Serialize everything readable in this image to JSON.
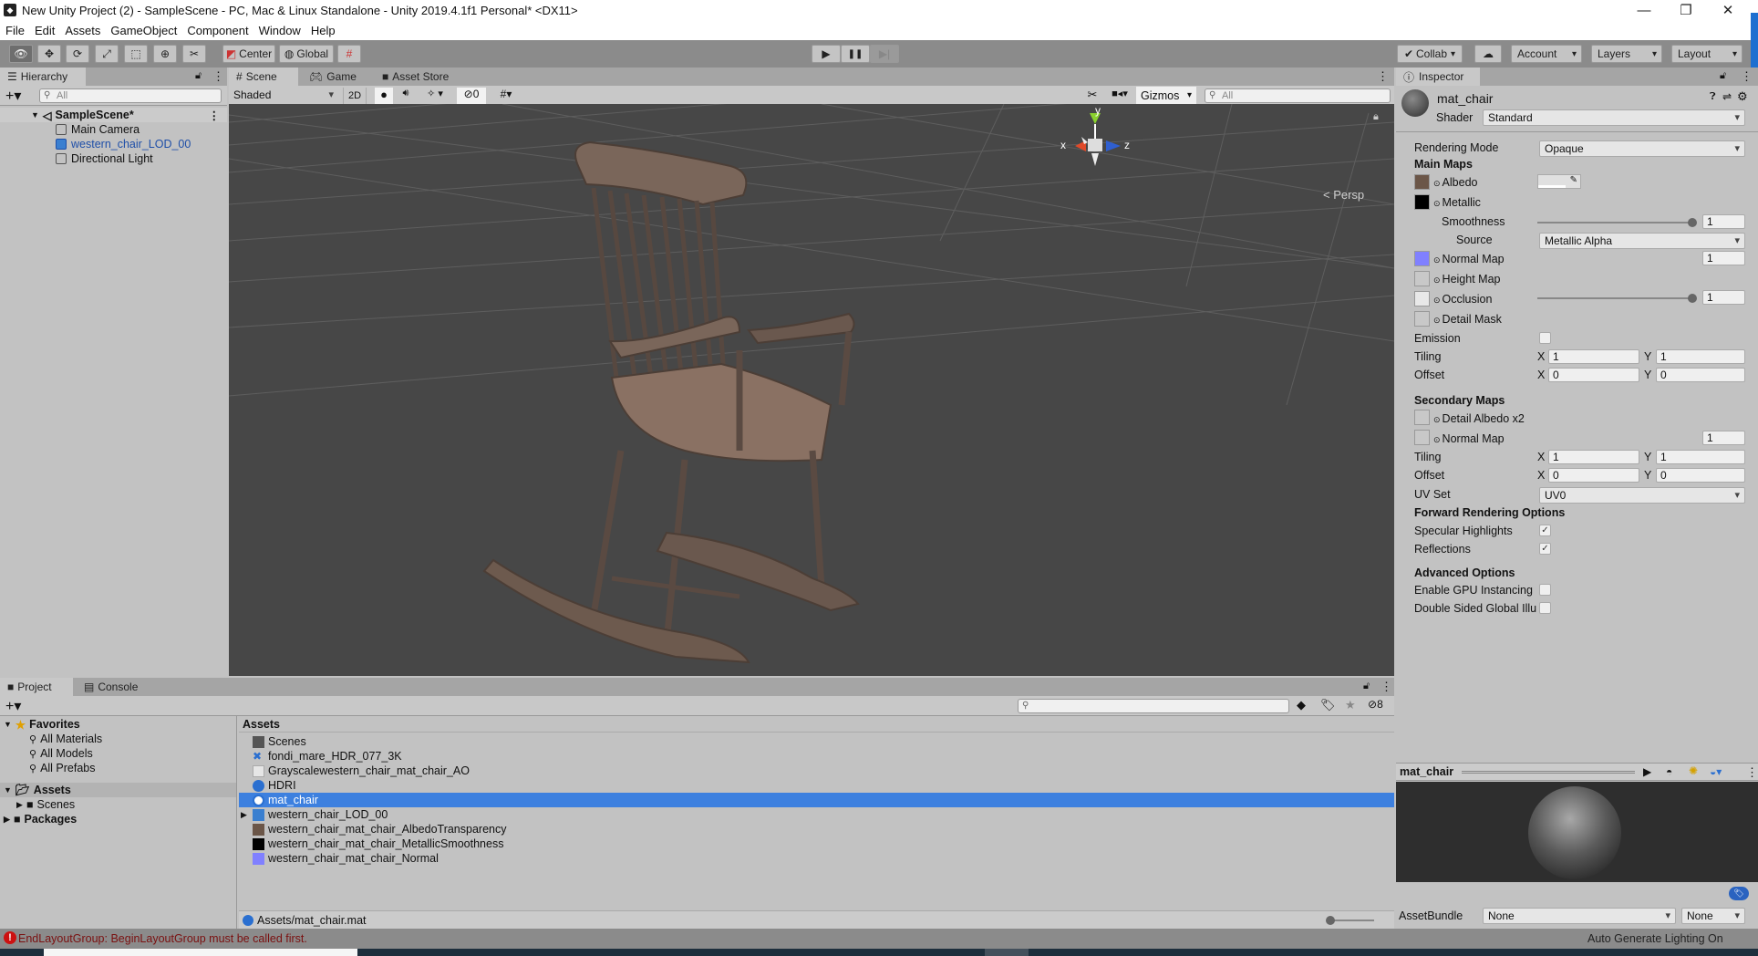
{
  "window": {
    "title": "New Unity Project (2) - SampleScene - PC, Mac & Linux Standalone - Unity 2019.4.1f1 Personal* <DX11>",
    "controls": {
      "minimize": "—",
      "maximize": "❐",
      "close": "✕"
    }
  },
  "menu": [
    "File",
    "Edit",
    "Assets",
    "GameObject",
    "Component",
    "Window",
    "Help"
  ],
  "toolbar": {
    "tools": [
      "view-tool",
      "move-tool",
      "rotate-tool",
      "scale-tool",
      "rect-tool",
      "transform-tool",
      "custom-tool"
    ],
    "pivot_label": "Center",
    "space_label": "Global",
    "play": "▶",
    "pause": "❚❚",
    "step": "▶|",
    "collab_label": "Collab",
    "account_label": "Account",
    "layers_label": "Layers",
    "layout_label": "Layout"
  },
  "hierarchy": {
    "tab": "Hierarchy",
    "search_placeholder": "All",
    "scene": "SampleScene*",
    "items": [
      {
        "label": "Main Camera",
        "selected": false
      },
      {
        "label": "western_chair_LOD_00",
        "prefab": true
      },
      {
        "label": "Directional Light"
      }
    ]
  },
  "scene_view": {
    "tabs": [
      "Scene",
      "Game",
      "Asset Store"
    ],
    "shading": "Shaded",
    "mode_2d": "2D",
    "hidden_count": "0",
    "gizmos_label": "Gizmos",
    "search_placeholder": "All",
    "axis_labels": {
      "x": "x",
      "y": "y",
      "z": "z"
    },
    "projection": "< Persp"
  },
  "inspector": {
    "tab": "Inspector",
    "asset_name": "mat_chair",
    "shader_label": "Shader",
    "shader_value": "Standard",
    "rendering_mode_label": "Rendering Mode",
    "rendering_mode_value": "Opaque",
    "main_maps_header": "Main Maps",
    "albedo": "Albedo",
    "metallic": "Metallic",
    "smoothness_label": "Smoothness",
    "smoothness_value": "1",
    "smoothness_fraction": 1.0,
    "source_label": "Source",
    "source_value": "Metallic Alpha",
    "normal_map": "Normal Map",
    "normal_map_value": "1",
    "height_map": "Height Map",
    "occlusion": "Occlusion",
    "occlusion_value": "1",
    "occlusion_fraction": 1.0,
    "detail_mask": "Detail Mask",
    "emission": "Emission",
    "emission_checked": false,
    "tiling_label": "Tiling",
    "offset_label": "Offset",
    "x": "X",
    "y": "Y",
    "main_tiling": {
      "x": "1",
      "y": "1"
    },
    "main_offset": {
      "x": "0",
      "y": "0"
    },
    "secondary_maps_header": "Secondary Maps",
    "detail_albedo": "Detail Albedo x2",
    "secondary_normal_map": "Normal Map",
    "secondary_normal_value": "1",
    "secondary_tiling": {
      "x": "1",
      "y": "1"
    },
    "secondary_offset": {
      "x": "0",
      "y": "0"
    },
    "uv_set_label": "UV Set",
    "uv_set_value": "UV0",
    "forward_header": "Forward Rendering Options",
    "specular_highlights": "Specular Highlights",
    "specular_checked": true,
    "reflections": "Reflections",
    "reflections_checked": true,
    "advanced_header": "Advanced Options",
    "gpu_instancing": "Enable GPU Instancing",
    "gpu_checked": false,
    "double_sided_gi": "Double Sided Global Illu",
    "double_sided_checked": false,
    "check_mark": "✓",
    "preview_title": "mat_chair",
    "assetbundle_label": "AssetBundle",
    "assetbundle_value": "None",
    "assetbundle_variant": "None",
    "colors": {
      "albedo_thumb": "#6b5648",
      "metallic_thumb": "#000000",
      "normal_thumb": "#8080ff"
    }
  },
  "project": {
    "tabs": [
      "Project",
      "Console"
    ],
    "hidden_count": "8",
    "favorites_label": "Favorites",
    "favorites": [
      "All Materials",
      "All Models",
      "All Prefabs"
    ],
    "assets_label": "Assets",
    "assets_children": [
      "Scenes"
    ],
    "packages_label": "Packages",
    "breadcrumb": "Assets",
    "files": [
      {
        "name": "Scenes",
        "icon": "folder-icon"
      },
      {
        "name": "fondi_mare_HDR_077_3K",
        "icon": "hdr-texture-icon"
      },
      {
        "name": "Grayscalewestern_chair_mat_chair_AO",
        "icon": "texture-icon"
      },
      {
        "name": "HDRI",
        "icon": "material-icon"
      },
      {
        "name": "mat_chair",
        "icon": "material-icon",
        "selected": true
      },
      {
        "name": "western_chair_LOD_00",
        "icon": "prefab-icon"
      },
      {
        "name": "western_chair_mat_chair_AlbedoTransparency",
        "icon": "texture-icon"
      },
      {
        "name": "western_chair_mat_chair_MetallicSmoothness",
        "icon": "texture-icon"
      },
      {
        "name": "western_chair_mat_chair_Normal",
        "icon": "texture-icon"
      }
    ],
    "footer_path": "Assets/mat_chair.mat"
  },
  "status": {
    "error": "EndLayoutGroup: BeginLayoutGroup must be called first.",
    "lighting": "Auto Generate Lighting On"
  },
  "colors": {
    "selection": "#3d80df",
    "error": "#8b1a1a",
    "prefab_text": "#1f4fa8"
  }
}
